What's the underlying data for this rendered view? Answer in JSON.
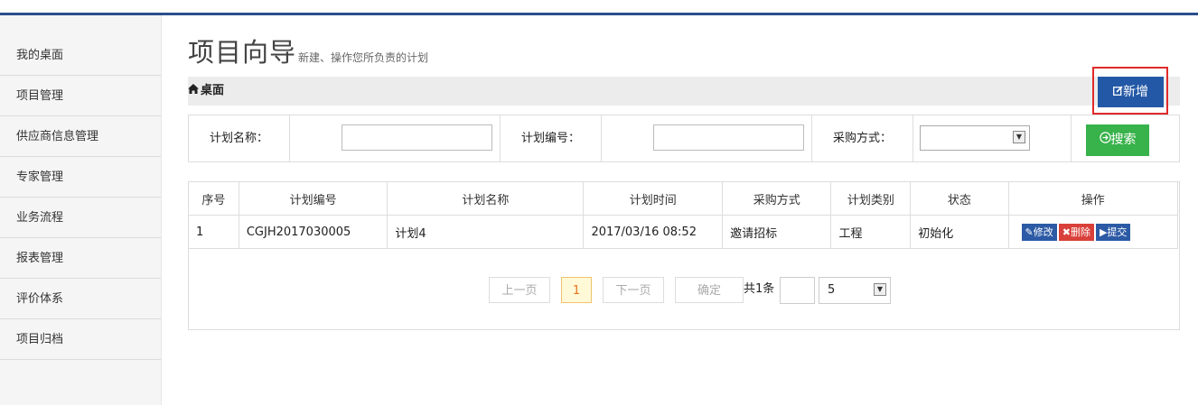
{
  "sidebar": {
    "items": [
      "我的桌面",
      "项目管理",
      "供应商信息管理",
      "专家管理",
      "业务流程",
      "报表管理",
      "评价体系",
      "项目归档"
    ]
  },
  "header": {
    "title": "项目向导",
    "subtitle": "新建、操作您所负责的计划"
  },
  "breadcrumb": {
    "home_icon": "home-icon",
    "label": "桌面"
  },
  "toolbar": {
    "new_label": "新增",
    "new_icon": "edit-icon"
  },
  "filters": {
    "plan_name_label": "计划名称：",
    "plan_name_value": "",
    "plan_no_label": "计划编号：",
    "plan_no_value": "",
    "purchase_method_label": "采购方式：",
    "purchase_method_value": "",
    "search_label": "搜索",
    "search_icon": "arrow-circle-icon"
  },
  "table": {
    "headers": [
      "序号",
      "计划编号",
      "计划名称",
      "计划时间",
      "采购方式",
      "计划类别",
      "状态",
      "操作"
    ],
    "rows": [
      {
        "index": "1",
        "plan_no": "CGJH2017030005",
        "plan_name": "计划4",
        "plan_time": "2017/03/16 08:52",
        "method": "邀请招标",
        "category": "工程",
        "status": "初始化"
      }
    ],
    "actions": {
      "edit": "修改",
      "delete": "删除",
      "submit": "提交"
    }
  },
  "pagination": {
    "prev_label": "上一页",
    "current_page": "1",
    "next_label": "下一页",
    "confirm_label": "确定",
    "total_text": "共1条",
    "page_input": "",
    "page_size": "5"
  },
  "colors": {
    "accent": "#2358a6",
    "search": "#38b24a",
    "delete": "#d9403a",
    "highlight_box": "#e02a2a"
  }
}
